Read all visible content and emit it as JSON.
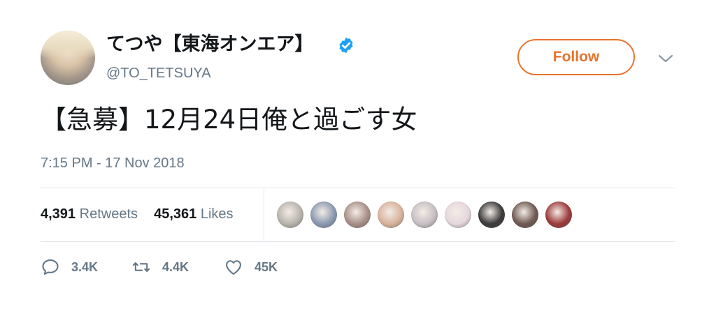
{
  "user": {
    "display_name": "てつや【東海オンエア】",
    "handle": "@TO_TETSUYA",
    "verified": true
  },
  "follow_button": {
    "label": "Follow",
    "color": "#e8732e"
  },
  "tweet": {
    "text": "【急募】12月24日俺と過ごす女",
    "timestamp": "7:15 PM - 17 Nov 2018"
  },
  "stats": {
    "retweets_count": "4,391",
    "retweets_label": "Retweets",
    "likes_count": "45,361",
    "likes_label": "Likes"
  },
  "likers": [
    "#b9b4ad",
    "#8a9ab0",
    "#a89088",
    "#d8b39c",
    "#c8bfc4",
    "#e6d7dc",
    "#3c3a3a",
    "#6f5a52",
    "#9c3b3a"
  ],
  "actions": {
    "replies": "3.4K",
    "retweets": "4.4K",
    "likes": "45K"
  },
  "colors": {
    "text": "#14171a",
    "secondary": "#657786",
    "divider": "#e1e8ed",
    "verified": "#1da1f2"
  },
  "icons": [
    "verified-icon",
    "chevron-down-icon",
    "reply-icon",
    "retweet-icon",
    "like-icon"
  ]
}
